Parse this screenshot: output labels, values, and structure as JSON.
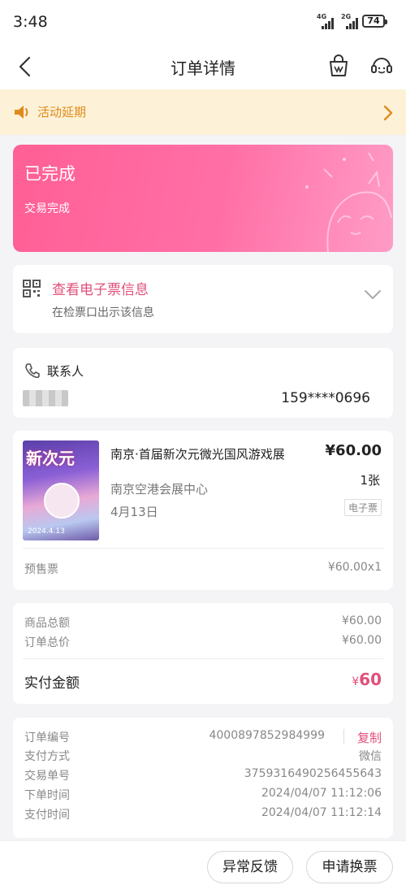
{
  "status_bar": {
    "time": "3:48",
    "net1": "4G",
    "net2": "2G",
    "battery": "74"
  },
  "header": {
    "title": "订单详情"
  },
  "notice": {
    "text": "活动延期"
  },
  "order_status": {
    "title": "已完成",
    "subtitle": "交易完成"
  },
  "eticket": {
    "title": "查看电子票信息",
    "subtitle": "在检票口出示该信息"
  },
  "contact": {
    "label": "联系人",
    "phone": "159****0696"
  },
  "product": {
    "poster_title": "新次元",
    "poster_date": "2024.4.13",
    "name": "南京·首届新次元微光国风游戏展",
    "price": "¥60.00",
    "quantity": "1张",
    "venue": "南京空港会展中心",
    "date": "4月13日",
    "tag": "电子票",
    "ticket_type": "预售票",
    "ticket_price": "¥60.00x1"
  },
  "amounts": {
    "goods_total_label": "商品总额",
    "goods_total_value": "¥60.00",
    "order_total_label": "订单总价",
    "order_total_value": "¥60.00",
    "paid_label": "实付金额",
    "paid_currency": "¥",
    "paid_value": "60"
  },
  "info": {
    "order_no_label": "订单编号",
    "order_no_value": "4000897852984999",
    "copy_label": "复制",
    "pay_method_label": "支付方式",
    "pay_method_value": "微信",
    "trade_no_label": "交易单号",
    "trade_no_value": "3759316490256455643",
    "order_time_label": "下单时间",
    "order_time_value": "2024/04/07 11:12:06",
    "pay_time_label": "支付时间",
    "pay_time_value": "2024/04/07 11:12:14"
  },
  "actions": {
    "feedback": "异常反馈",
    "exchange": "申请换票"
  },
  "colors": {
    "accent": "#e0507a",
    "notice_text": "#e08a1a",
    "notice_bg": "#fdf2d8"
  }
}
